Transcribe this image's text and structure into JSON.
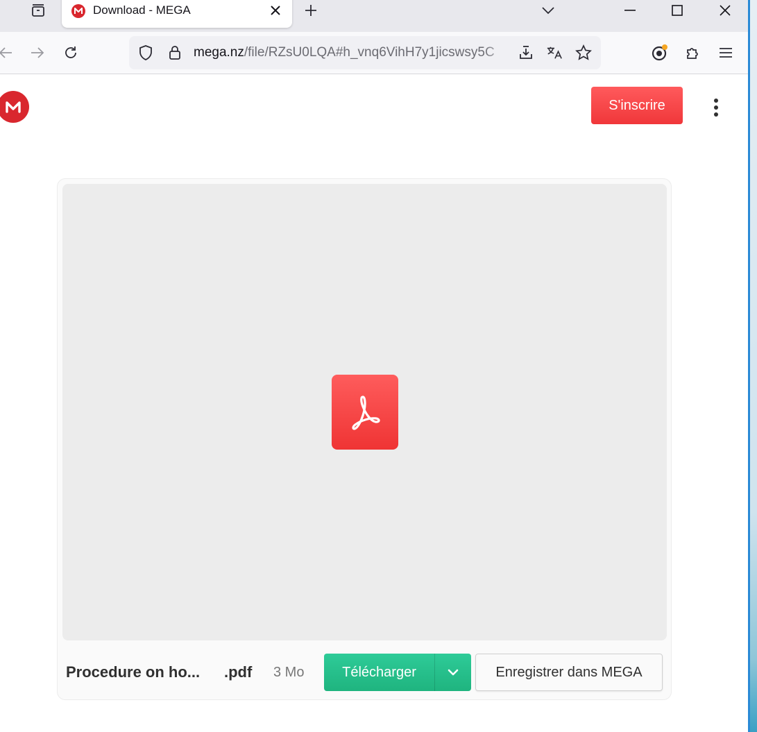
{
  "browser": {
    "tab": {
      "title": "Download - MEGA",
      "favicon": "mega-favicon"
    },
    "url": {
      "host": "mega.nz",
      "path": "/file/RZsU0LQA#h_vnq6VihH7y1jicswsy5C"
    },
    "icons": {
      "tab_list": "tab-list-icon",
      "close_tab": "close-icon",
      "new_tab": "plus-icon",
      "tabs_overflow": "chevron-down-icon",
      "back": "back-arrow-icon",
      "forward": "forward-arrow-icon",
      "reload": "reload-icon",
      "shield": "shield-icon",
      "lock": "lock-icon",
      "page_download": "page-download-icon",
      "translate": "translate-icon",
      "bookmark": "star-icon",
      "account": "account-icon",
      "extensions": "puzzle-icon",
      "menu": "hamburger-icon"
    }
  },
  "page": {
    "header": {
      "signup_label": "S'inscrire"
    },
    "file": {
      "name": "Procedure on ho...",
      "extension": ".pdf",
      "size": "3 Mo",
      "type_icon": "pdf-icon"
    },
    "actions": {
      "download_label": "Télécharger",
      "save_label": "Enregistrer dans MEGA"
    }
  },
  "colors": {
    "mega_red": "#d9272e",
    "signup_red": "#f0373a",
    "download_green": "#1fb47f",
    "pdf_red": "#ef3434",
    "preview_bg": "#ececec"
  }
}
